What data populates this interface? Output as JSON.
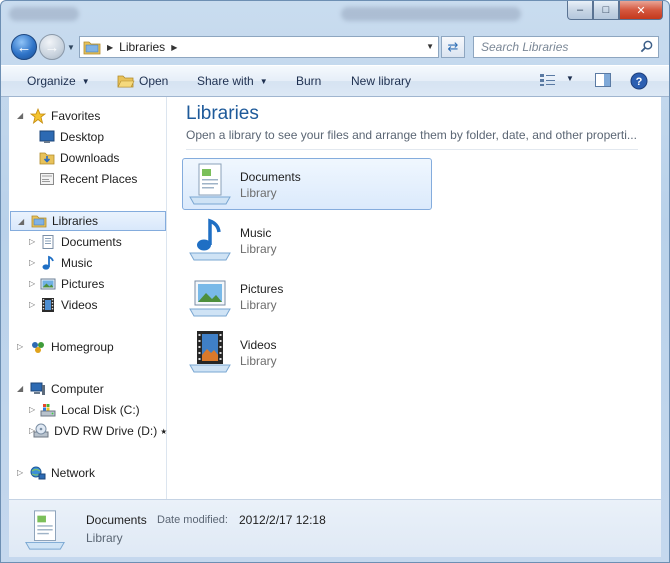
{
  "window": {
    "minimize_glyph": "–",
    "maximize_glyph": "□",
    "close_glyph": "✕"
  },
  "address": {
    "breadcrumb": "Libraries",
    "search_placeholder": "Search Libraries"
  },
  "toolbar": {
    "organize": "Organize",
    "open": "Open",
    "share_with": "Share with",
    "burn": "Burn",
    "new_library": "New library"
  },
  "nav": {
    "favorites": "Favorites",
    "desktop": "Desktop",
    "downloads": "Downloads",
    "recent_places": "Recent Places",
    "libraries": "Libraries",
    "documents": "Documents",
    "music": "Music",
    "pictures": "Pictures",
    "videos": "Videos",
    "homegroup": "Homegroup",
    "computer": "Computer",
    "local_disk": "Local Disk (C:)",
    "dvd_drive": "DVD RW Drive (D:) ⭑",
    "network": "Network"
  },
  "main": {
    "title": "Libraries",
    "subtitle": "Open a library to see your files and arrange them by folder, date, and other properti...",
    "libraries": [
      {
        "name": "Documents",
        "kind": "Library",
        "icon": "documents-library-icon",
        "selected": true
      },
      {
        "name": "Music",
        "kind": "Library",
        "icon": "music-library-icon",
        "selected": false
      },
      {
        "name": "Pictures",
        "kind": "Library",
        "icon": "pictures-library-icon",
        "selected": false
      },
      {
        "name": "Videos",
        "kind": "Library",
        "icon": "videos-library-icon",
        "selected": false
      }
    ]
  },
  "details": {
    "name": "Documents",
    "modified_label": "Date modified:",
    "modified_value": "2012/2/17 12:18",
    "kind": "Library"
  },
  "colors": {
    "accent_title": "#1e5a9a",
    "selection_border": "#84acdd",
    "selection_fill": "#dbeafc"
  }
}
